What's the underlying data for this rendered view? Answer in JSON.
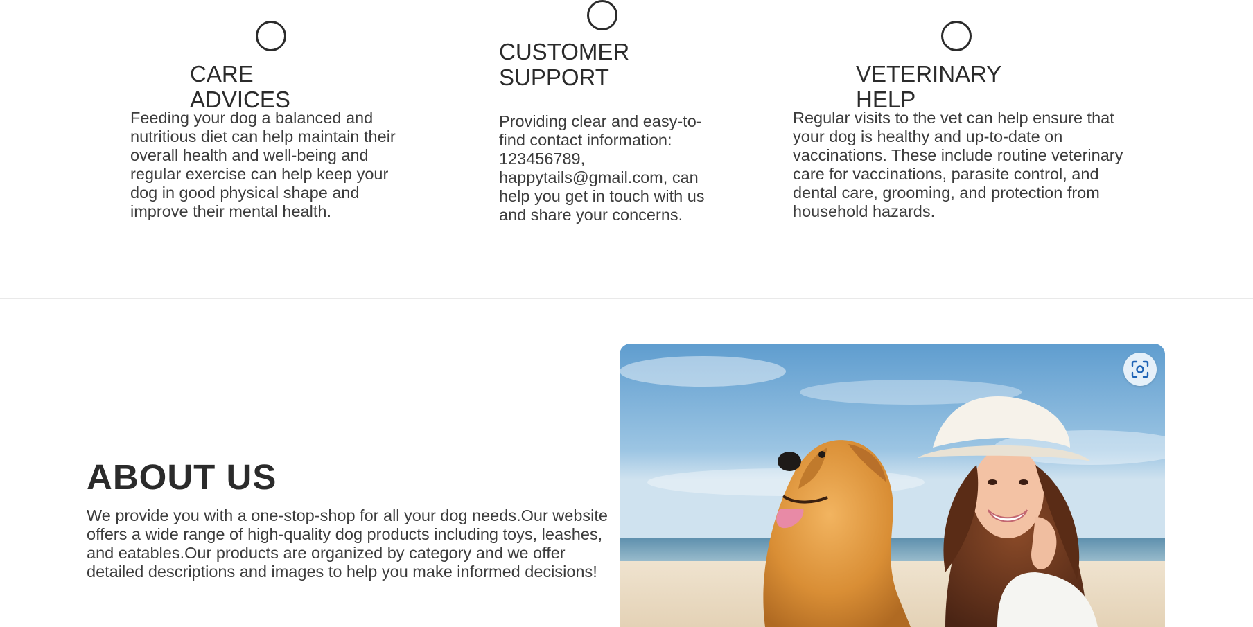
{
  "features": [
    {
      "title": "CARE ADVICES",
      "text": "Feeding your dog a balanced and nutritious diet can help maintain their overall health and well-being and regular exercise can help keep your dog in good physical shape and improve their mental health."
    },
    {
      "title_line1": "CUSTOMER",
      "title_line2": "SUPPORT",
      "text": "Providing clear and easy-to-find contact information: 123456789, happytails@gmail.com, can help you get in touch with us and share your concerns."
    },
    {
      "title": "VETERINARY HELP",
      "text": "Regular visits to the vet can help ensure that your dog is healthy and up-to-date on vaccinations. These include routine veterinary care for vaccinations, parasite control, and dental care, grooming, and protection from household hazards."
    }
  ],
  "about": {
    "title": "ABOUT US",
    "text": "We provide you with a one-stop-shop for all your dog needs.Our website offers a wide range of high-quality dog products including toys, leashes, and eatables.Our products are organized by category and we offer detailed descriptions and images to help you make informed decisions!"
  },
  "photo": {
    "icon": "visual-search-icon"
  }
}
